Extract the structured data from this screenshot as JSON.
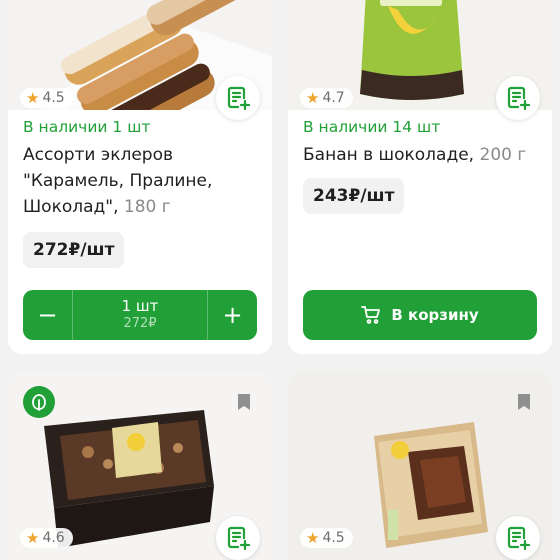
{
  "products": [
    {
      "rating": "4.5",
      "stock": "В наличии 1 шт",
      "title": "Ассорти эклеров \"Карамель, Пралине, Шоколад\",",
      "weight": "180 г",
      "price": "272₽/шт",
      "stepper": {
        "minus": "−",
        "qty": "1 шт",
        "sum": "272₽",
        "plus": "+"
      }
    },
    {
      "rating": "4.7",
      "stock": "В наличии 14 шт",
      "title": "Банан в шоколаде,",
      "weight": "200 г",
      "price": "243₽/шт",
      "cart_label": "В корзину"
    },
    {
      "rating": "4.6"
    },
    {
      "rating": "4.5"
    }
  ],
  "icons": {
    "rating": "star-icon",
    "list": "add-to-list-icon",
    "cart": "cart-icon",
    "badge": "leaf-icon",
    "favorite": "bookmark-icon"
  },
  "colors": {
    "accent": "#21a038",
    "star": "#f0a22b",
    "background": "#f2f2f2"
  }
}
